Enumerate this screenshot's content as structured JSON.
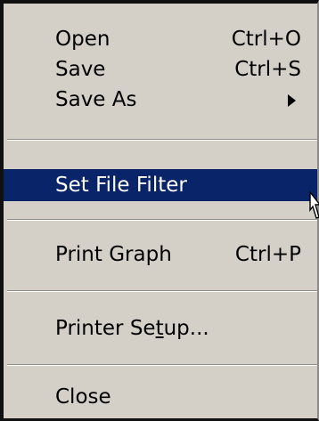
{
  "menu": {
    "items": [
      {
        "label": "Open",
        "shortcut": "Ctrl+O"
      },
      {
        "label": "Save",
        "shortcut": "Ctrl+S"
      },
      {
        "label": "Save As",
        "submenu_icon": "submenu-arrow-icon"
      },
      {
        "label": "Set File Filter",
        "selected": true
      },
      {
        "label": "Print Graph",
        "shortcut": "Ctrl+P"
      },
      {
        "label_before": "Printer Se",
        "mnemonic": "t",
        "label_after": "up..."
      },
      {
        "label": "Close"
      }
    ]
  },
  "colors": {
    "menu_bg": "#d4d0c8",
    "highlight_bg": "#0a246a",
    "highlight_text": "#ffffff",
    "text": "#000000"
  },
  "icons": {
    "cursor": "mouse-pointer-icon"
  }
}
